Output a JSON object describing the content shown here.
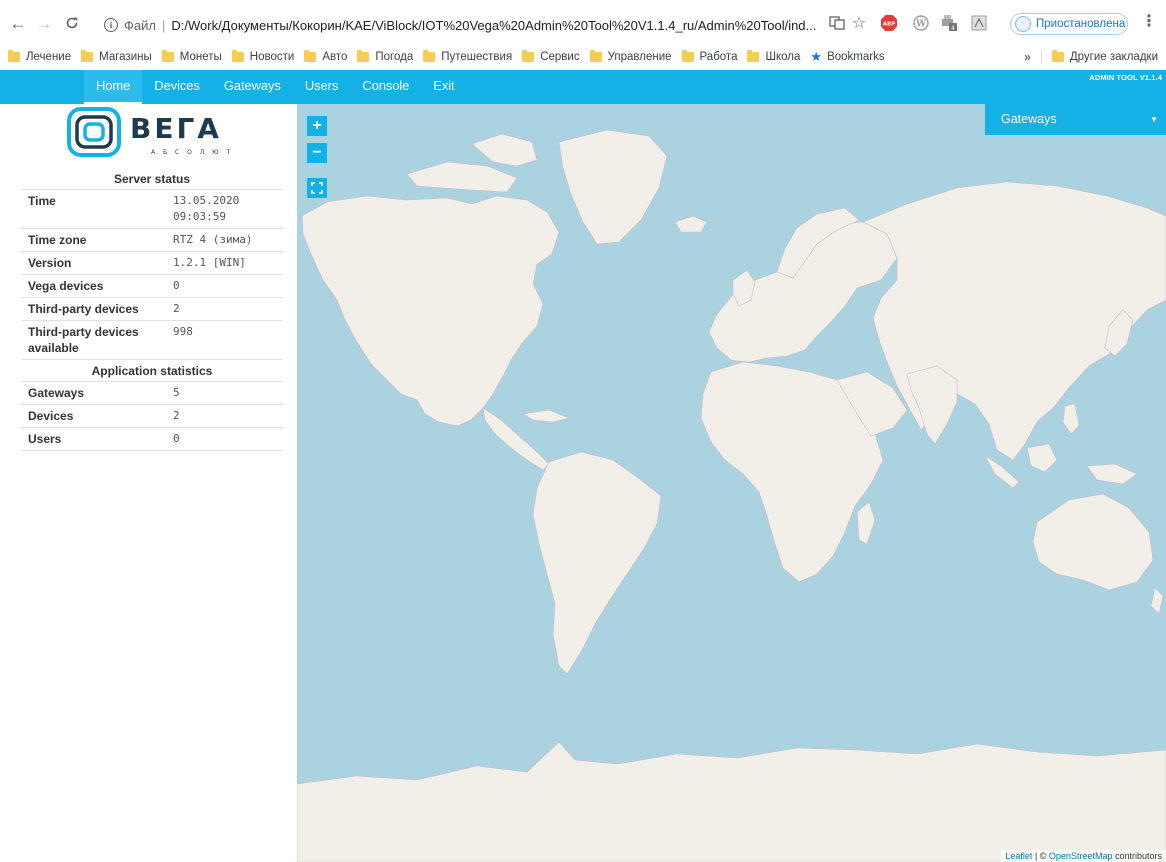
{
  "browser": {
    "address": {
      "scheme_label": "Файл",
      "separator": "|",
      "url": "D:/Work/Документы/Кокорин/KAE/ViBlock/IOT%20Vega%20Admin%20Tool%20V1.1.4_ru/Admin%20Tool/ind..."
    },
    "extensions": [
      "translate-icon",
      "star-icon",
      "adblock-icon",
      "wordpress-icon",
      "printer-icon",
      "pdf-icon"
    ],
    "profile_status": "Приостановлена",
    "bookmarks": [
      "Лечение",
      "Магазины",
      "Монеты",
      "Новости",
      "Авто",
      "Погода",
      "Путешествия",
      "Сервис",
      "Управление",
      "Работа",
      "Школа"
    ],
    "bookmarks_starred": "Bookmarks",
    "bookmarks_overflow": "»",
    "other_bookmarks": "Другие закладки"
  },
  "navbar": {
    "items": [
      {
        "label": "Home",
        "active": true
      },
      {
        "label": "Devices",
        "active": false
      },
      {
        "label": "Gateways",
        "active": false
      },
      {
        "label": "Users",
        "active": false
      },
      {
        "label": "Console",
        "active": false
      },
      {
        "label": "Exit",
        "active": false
      }
    ],
    "version": "ADMIN TOOL V1.1.4",
    "accent_color": "#14b1e7"
  },
  "logo": {
    "wordmark": "ВЕГА",
    "subtitle": "А Б С О Л Ю Т",
    "color": "#14b1e7"
  },
  "server_status": {
    "title": "Server status",
    "rows": [
      {
        "key": "Time",
        "value": "13.05.2020",
        "value2": "09:03:59"
      },
      {
        "key": "Time zone",
        "value": "RTZ 4 (зима)"
      },
      {
        "key": "Version",
        "value": "1.2.1 [WIN]"
      },
      {
        "key": "Vega devices",
        "value": "0"
      },
      {
        "key": "Third-party devices",
        "value": "2"
      },
      {
        "key": "Third-party devices available",
        "value": "998"
      }
    ]
  },
  "app_statistics": {
    "title": "Application statistics",
    "rows": [
      {
        "key": "Gateways",
        "value": "5"
      },
      {
        "key": "Devices",
        "value": "2"
      },
      {
        "key": "Users",
        "value": "0"
      }
    ]
  },
  "map": {
    "zoom_in": "+",
    "zoom_out": "−",
    "fullscreen_icon": "fullscreen-icon",
    "gateways_dropdown": "Gateways",
    "attribution": {
      "leaflet": "Leaflet",
      "sep": " | © ",
      "osm": "OpenStreetMap",
      "rest": " contributors"
    },
    "water_color": "#aad3df",
    "land_color": "#f2efe9"
  }
}
